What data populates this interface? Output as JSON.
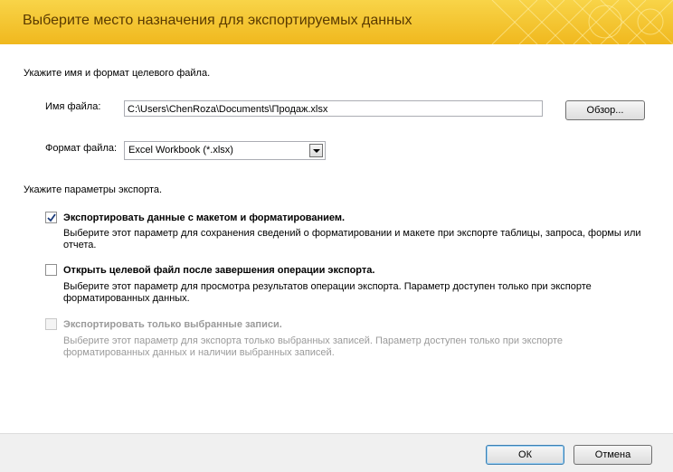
{
  "dialog": {
    "title": "Выберите место назначения для экспортируемых данных"
  },
  "file_section": {
    "label": "Укажите имя и формат целевого файла.",
    "filename_label": "Имя файла:",
    "filename_value": "C:\\Users\\ChenRoza\\Documents\\Продаж.xlsx",
    "browse_label": "Обзор...",
    "format_label": "Формат файла:",
    "format_value": "Excel Workbook (*.xlsx)"
  },
  "export_section": {
    "label": "Укажите параметры экспорта.",
    "options": [
      {
        "title": "Экспортировать данные с макетом и форматированием.",
        "description": "Выберите этот параметр для сохранения сведений о форматировании и макете при экспорте таблицы, запроса, формы или отчета.",
        "checked": true,
        "enabled": true
      },
      {
        "title": "Открыть целевой файл после завершения операции экспорта.",
        "description": "Выберите этот параметр для просмотра результатов операции экспорта. Параметр доступен только при экспорте форматированных данных.",
        "checked": false,
        "enabled": true
      },
      {
        "title": "Экспортировать только выбранные записи.",
        "description": "Выберите этот параметр для экспорта только выбранных записей. Параметр доступен только при экспорте форматированных данных и наличии выбранных записей.",
        "checked": false,
        "enabled": false
      }
    ]
  },
  "footer": {
    "ok_label": "ОК",
    "cancel_label": "Отмена"
  },
  "colors": {
    "header_top": "#f8d448",
    "header_bottom": "#f0b81e",
    "header_text": "#5a3a00"
  },
  "icons": {
    "checkmark": "check-icon",
    "dropdown": "chevron-down-icon"
  }
}
